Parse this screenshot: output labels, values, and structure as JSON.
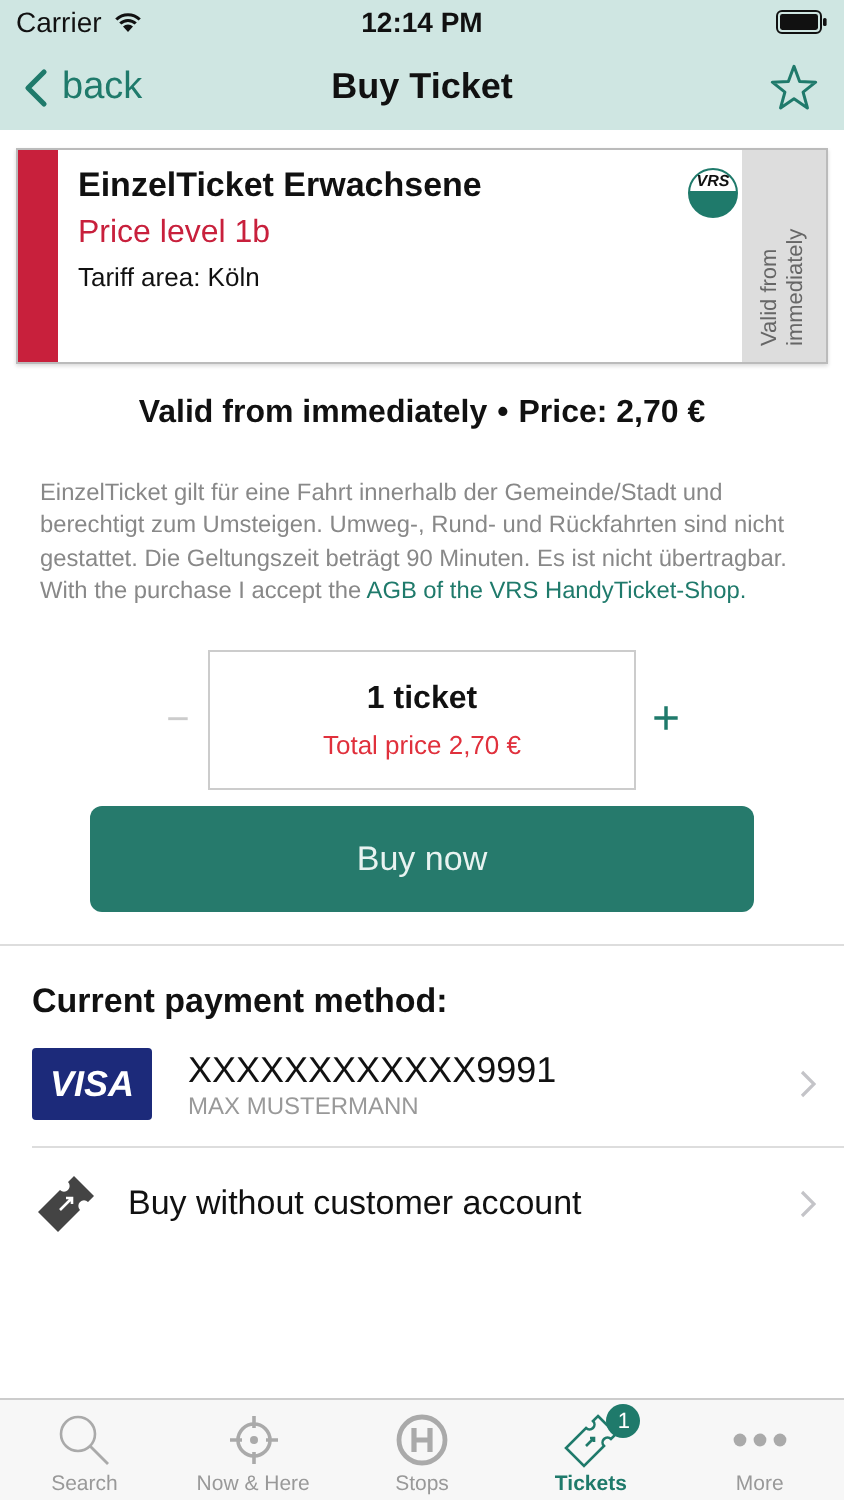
{
  "status_bar": {
    "carrier": "Carrier",
    "time": "12:14 PM"
  },
  "nav": {
    "back": "back",
    "title": "Buy Ticket",
    "favorite": false
  },
  "ticket": {
    "name": "EinzelTicket Erwachsene",
    "price_level": "Price level 1b",
    "tariff_area": "Tariff area: Köln",
    "logo": "VRS",
    "validity": "Valid from immediately"
  },
  "summary": {
    "validity": "Valid from immediately",
    "separator": "•",
    "price": "Price: 2,70 €"
  },
  "description": "EinzelTicket gilt für eine Fahrt innerhalb der Gemeinde/Stadt und berechtigt zum Umsteigen. Umweg-, Rund- und Rückfahrten sind nicht gestattet. Die Geltungszeit beträgt 90 Minuten. Es ist nicht übertragbar.",
  "agb": {
    "text": "With the purchase I accept the",
    "link": "AGB of the VRS HandyTicket-Shop."
  },
  "stepper": {
    "minus": "−",
    "plus": "+",
    "minus_disabled": true,
    "count": "1 ticket",
    "total": "Total price 2,70 €"
  },
  "buy_button": "Buy now",
  "payment": {
    "heading": "Current payment method:",
    "options": [
      {
        "kind": "card",
        "logo": "VISA",
        "title": "XXXXXXXXXXXX9991",
        "subtitle": "MAX MUSTERMANN"
      },
      {
        "kind": "guest",
        "title": "Buy without customer account"
      }
    ]
  },
  "tab_bar": [
    {
      "kind": "search",
      "label": "Search",
      "selected": false
    },
    {
      "kind": "locate",
      "label": "Now & Here",
      "selected": false
    },
    {
      "kind": "stops",
      "label": "Stops",
      "selected": false
    },
    {
      "kind": "tickets",
      "label": "Tickets",
      "selected": true,
      "badge": "1"
    },
    {
      "kind": "more",
      "label": "More",
      "selected": false
    }
  ]
}
